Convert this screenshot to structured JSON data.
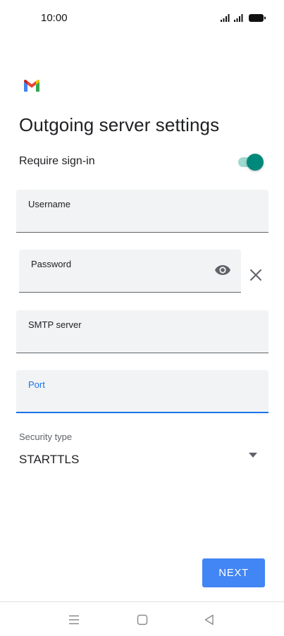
{
  "status_bar": {
    "time": "10:00",
    "icons": [
      "signal-icon",
      "signal-icon",
      "battery-icon"
    ]
  },
  "app": {
    "logo": "gmail-logo",
    "title": "Outgoing server settings"
  },
  "require_signin": {
    "label": "Require sign-in",
    "enabled": true
  },
  "fields": {
    "username": {
      "label": "Username",
      "value": ""
    },
    "password": {
      "label": "Password",
      "value": "",
      "icons": [
        "eye-icon",
        "close-icon"
      ]
    },
    "smtp_server": {
      "label": "SMTP server",
      "value": ""
    },
    "port": {
      "label": "Port",
      "value": "",
      "focused": true
    }
  },
  "security": {
    "label": "Security type",
    "selected": "STARTTLS"
  },
  "actions": {
    "next_label": "NEXT"
  },
  "colors": {
    "accent": "#1a73e8",
    "button": "#4285f4",
    "toggle": "#00897b",
    "field_bg": "#f1f3f4"
  }
}
